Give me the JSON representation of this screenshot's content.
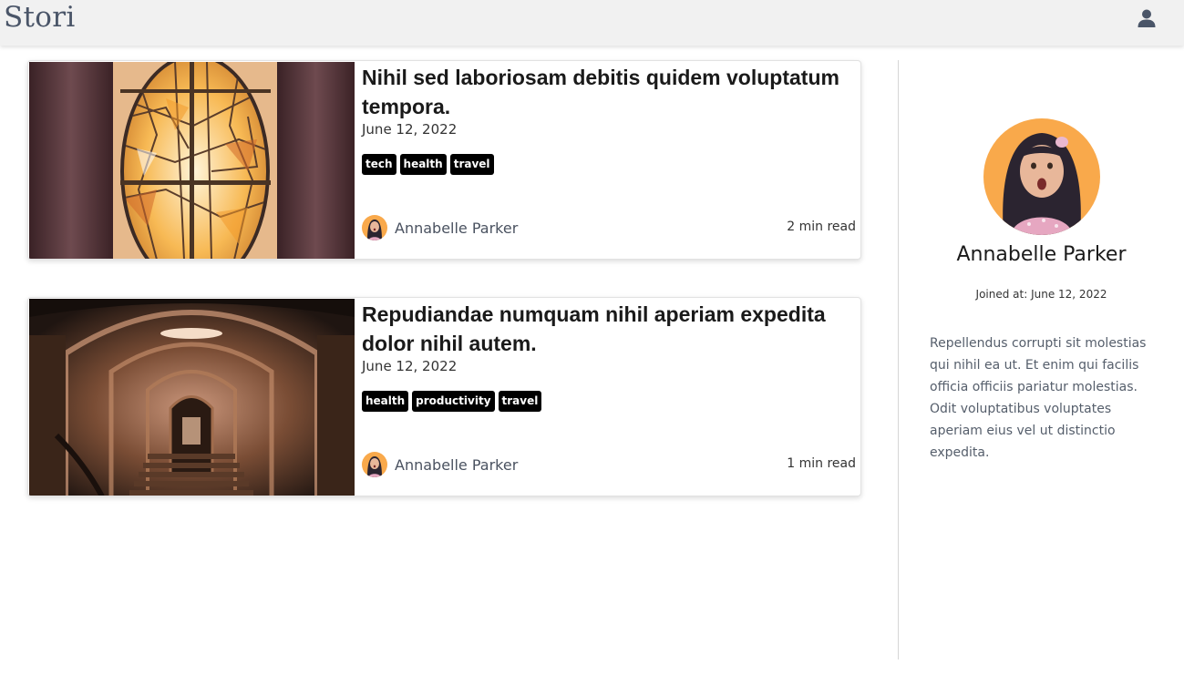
{
  "header": {
    "brand": "Stori",
    "user_icon": "user-icon"
  },
  "colors": {
    "navbar_bg": "#f1f1f1",
    "brand_text": "#4a5568",
    "tag_bg": "#000000",
    "avatar_bg": "#f9a94b"
  },
  "posts": [
    {
      "title": "Nihil sed laboriosam debitis quidem voluptatum tempora.",
      "date": "June 12, 2022",
      "tags": [
        "tech",
        "health",
        "travel"
      ],
      "author": "Annabelle Parker",
      "read_time": "2 min read",
      "image": "stained-glass-window"
    },
    {
      "title": "Repudiandae numquam nihil aperiam expedita dolor nihil autem.",
      "date": "June 12, 2022",
      "tags": [
        "health",
        "productivity",
        "travel"
      ],
      "author": "Annabelle Parker",
      "read_time": "1 min read",
      "image": "vaulted-corridor"
    }
  ],
  "profile": {
    "name": "Annabelle Parker",
    "joined": "Joined at: June 12, 2022",
    "bio": "Repellendus corrupti sit molestias qui nihil ea ut. Et enim qui facilis officia officiis pariatur molestias. Odit voluptatibus voluptates aperiam eius vel ut distinctio expedita."
  }
}
